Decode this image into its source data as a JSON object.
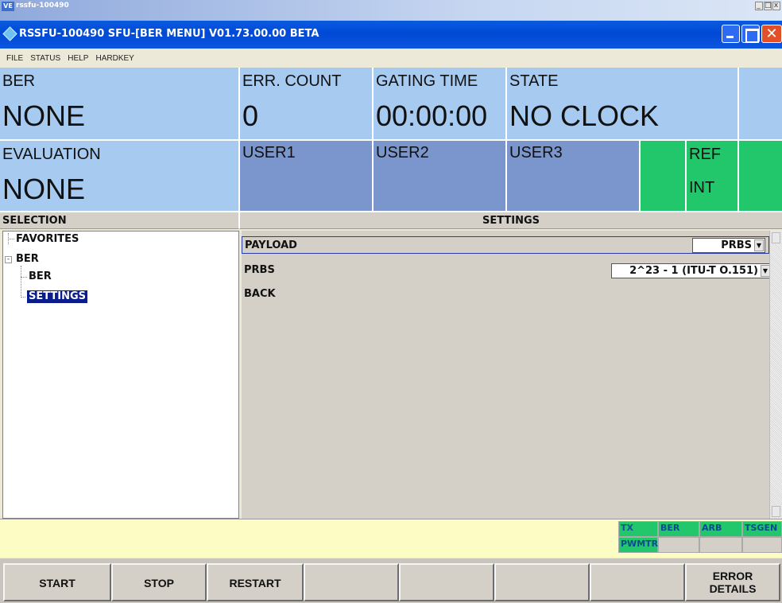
{
  "outer_window": {
    "title": "rssfu-100490",
    "icon_text": "VE",
    "controls": [
      "_",
      "□",
      "x"
    ]
  },
  "app_window": {
    "title": "RSSFU-100490  SFU-[BER MENU]  V01.73.00.00 BETA",
    "close_glyph": "✕"
  },
  "menu": [
    "FILE",
    "STATUS",
    "HELP",
    "HARDKEY"
  ],
  "status": {
    "ber": {
      "label": "BER",
      "value": "NONE"
    },
    "err_count": {
      "label": "ERR. COUNT",
      "value": "0"
    },
    "gating_time": {
      "label": "GATING TIME",
      "value": "00:00:00"
    },
    "state": {
      "label": "STATE",
      "value": "NO CLOCK"
    },
    "evaluation": {
      "label": "EVALUATION",
      "value": "NONE"
    },
    "user1": "USER1",
    "user2": "USER2",
    "user3": "USER3",
    "ref": {
      "label": "REF",
      "value": "INT"
    }
  },
  "selection": {
    "header": "SELECTION",
    "tree": {
      "favorites": "FAVORITES",
      "ber": "BER",
      "ber_child": "BER",
      "settings": "SETTINGS",
      "expander": "-"
    }
  },
  "settings": {
    "header": "SETTINGS",
    "rows": {
      "payload": {
        "label": "PAYLOAD",
        "value": "PRBS"
      },
      "prbs": {
        "label": "PRBS",
        "value": "2^23 - 1 (ITU-T O.151)"
      },
      "back": {
        "label": "BACK"
      }
    },
    "dropdown_arrow": "▼"
  },
  "status_tabs": {
    "tx": "TX",
    "ber": "BER",
    "arb": "ARB",
    "tsgen": "TSGEN",
    "pwmtr": "PWMTR"
  },
  "softkeys": {
    "start": "START",
    "stop": "STOP",
    "restart": "RESTART",
    "error_details_1": "ERROR",
    "error_details_2": "DETAILS"
  },
  "colors": {
    "status_panel": "#a6caf0",
    "user_panel": "#7b96cc",
    "green_panel": "#22c66b",
    "title_bar": "#0049d6",
    "selection_highlight": "#0b1d8a",
    "status_strip": "#fdfcc4"
  }
}
